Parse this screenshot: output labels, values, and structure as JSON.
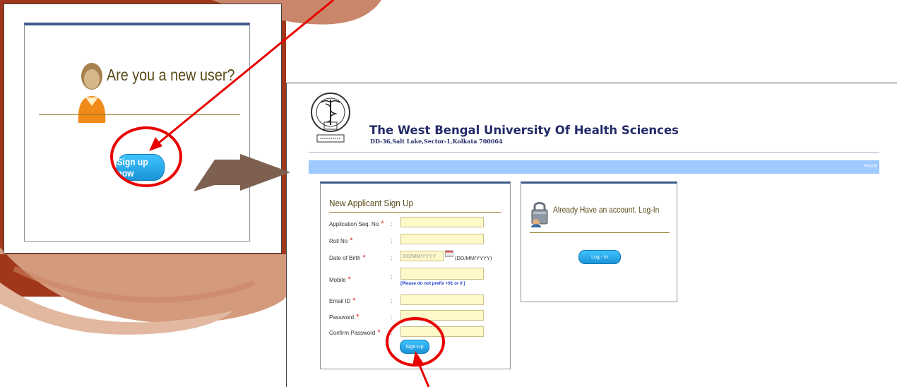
{
  "colors": {
    "accent": "#1b93d8",
    "heading_gold": "#5a4a18",
    "brand_navy": "#242a68",
    "nav_bar": "#9fcaff",
    "annotation_red": "#e80000",
    "annotation_arrow": "#7d6050"
  },
  "icons": {
    "user": "user-silhouette-icon",
    "lock": "padlock-user-icon",
    "calendar": "calendar-icon",
    "logo": "university-seal-logo"
  },
  "zoom_card": {
    "title": "Are you a new user?",
    "button_label": "Sign up now"
  },
  "header": {
    "university_name": "The West Bengal University Of Health Sciences",
    "address": "DD-36,Salt Lake,Sector-1,Kolkata 700064",
    "nav_home": "Home"
  },
  "signup_form": {
    "title": "New Applicant Sign Up",
    "fields": [
      {
        "label": "Application Seq. No",
        "value": "",
        "placeholder": ""
      },
      {
        "label": "Roll No",
        "value": "",
        "placeholder": ""
      },
      {
        "label": "Date of Birth",
        "value": "",
        "placeholder": "DD/MM/YYYY"
      },
      {
        "label": "Mobile",
        "value": "",
        "placeholder": ""
      },
      {
        "label": "Email ID",
        "value": "",
        "placeholder": ""
      },
      {
        "label": "Password",
        "value": "",
        "placeholder": ""
      },
      {
        "label": "Confirm Password",
        "value": "",
        "placeholder": ""
      }
    ],
    "required_mark": "*",
    "separator": ":",
    "date_format_hint": "(DD/MM/YYYY)",
    "mobile_note": "[Please do not prefix +91 or 0 ]",
    "submit_label": "Sign-Up"
  },
  "login_panel": {
    "title": "Already Have an account. Log-In",
    "button_label": "Log - In"
  }
}
